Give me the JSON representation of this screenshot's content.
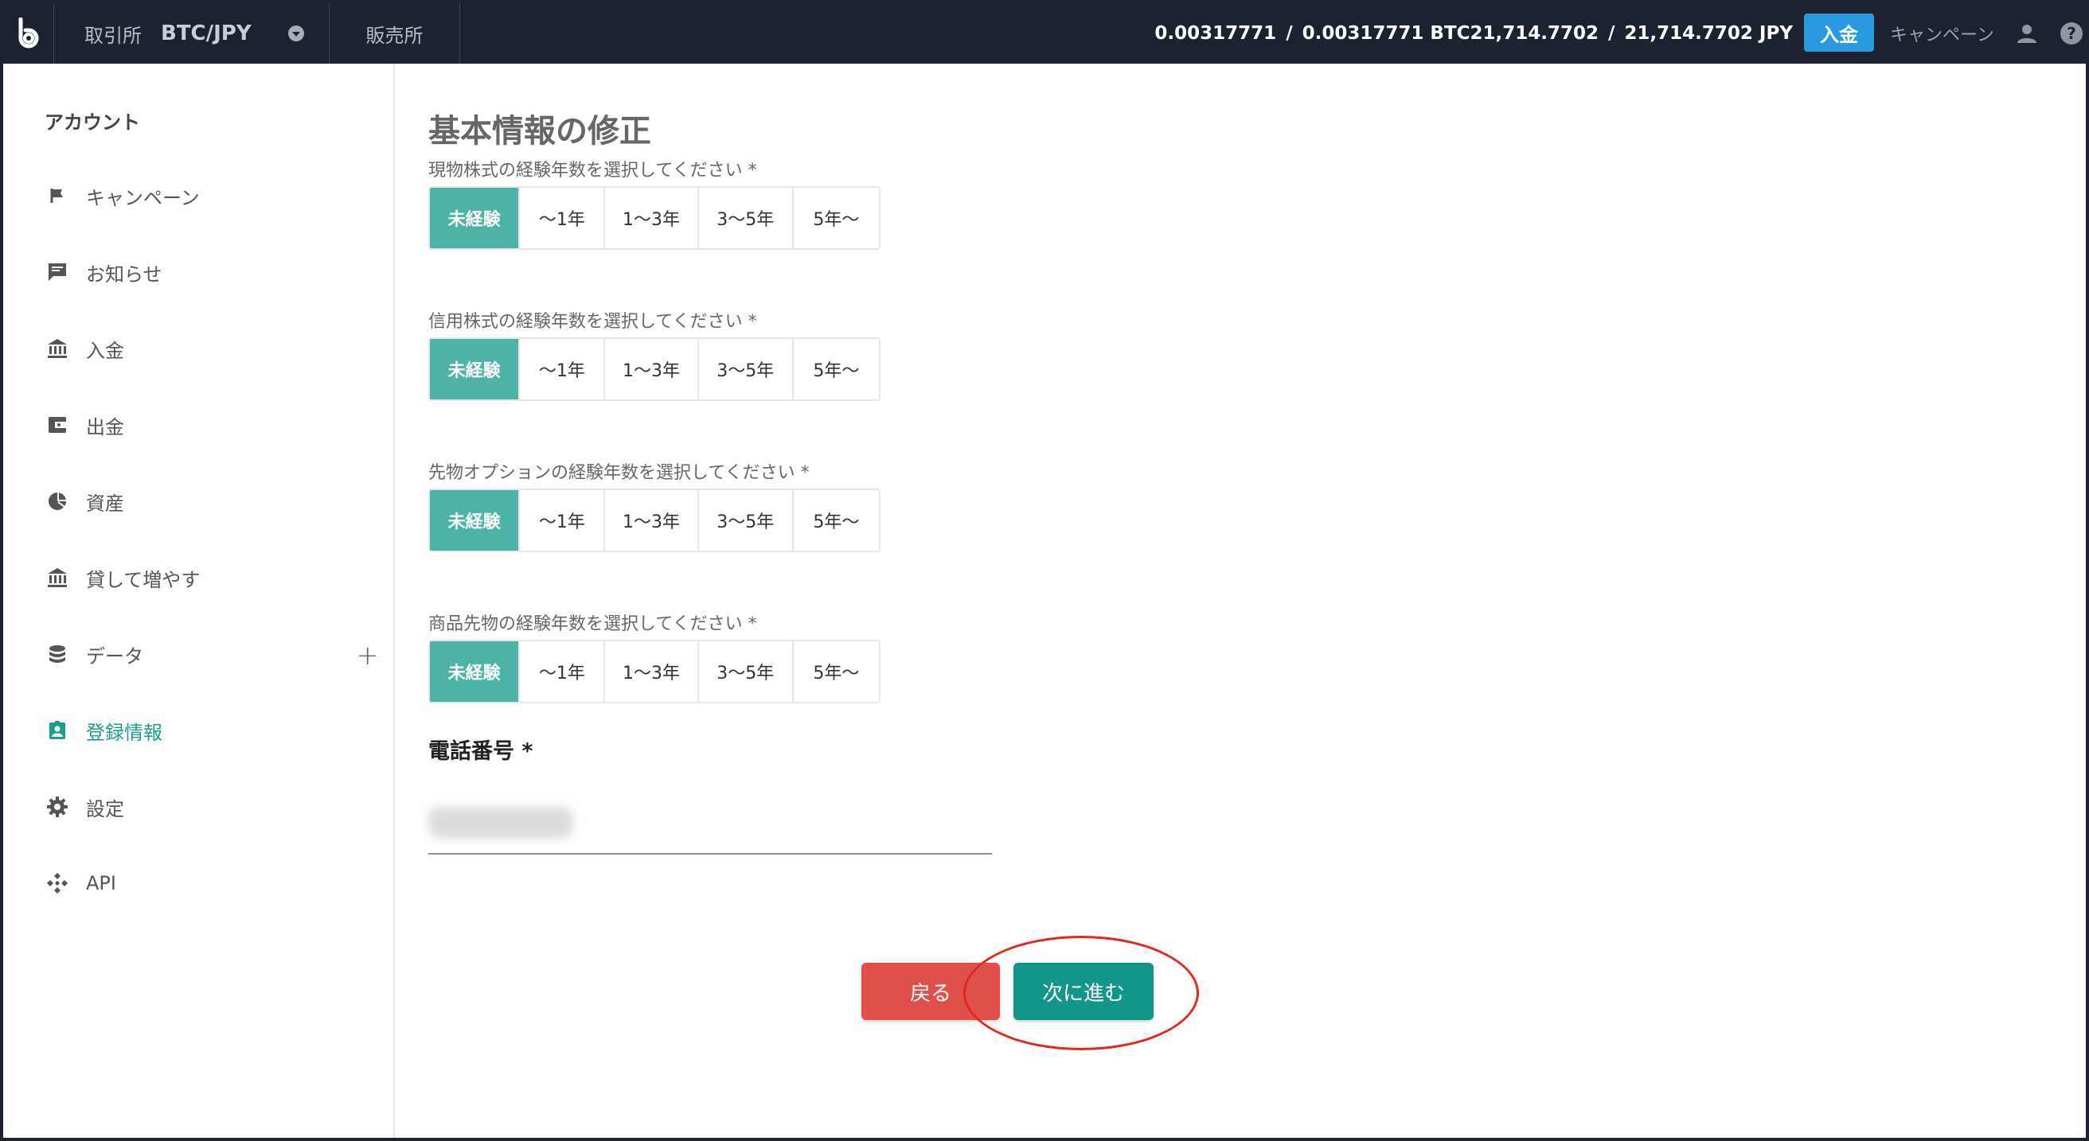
{
  "topbar": {
    "exchange_label": "取引所",
    "pair": "BTC/JPY",
    "shop_label": "販売所",
    "btc_available": "0.00317771",
    "btc_total": "0.00317771 BTC",
    "jpy_available": "21,714.7702",
    "jpy_total": "21,714.7702 JPY",
    "separator": "/",
    "deposit_label": "入金",
    "campaign_label": "キャンペーン",
    "accent": "#2a9ae0"
  },
  "sidebar": {
    "title": "アカウント",
    "items": [
      {
        "label": "キャンペーン",
        "icon": "flag-icon"
      },
      {
        "label": "お知らせ",
        "icon": "message-icon"
      },
      {
        "label": "入金",
        "icon": "bank-icon"
      },
      {
        "label": "出金",
        "icon": "wallet-icon"
      },
      {
        "label": "資産",
        "icon": "pie-chart-icon"
      },
      {
        "label": "貸して増やす",
        "icon": "bank-icon"
      },
      {
        "label": "データ",
        "icon": "database-icon",
        "expand": "+"
      },
      {
        "label": "登録情報",
        "icon": "id-card-icon",
        "active": true
      },
      {
        "label": "設定",
        "icon": "gear-icon"
      },
      {
        "label": "API",
        "icon": "api-icon"
      }
    ],
    "active_color": "#1a9e8e"
  },
  "form": {
    "title": "基本情報の修正",
    "options": [
      "未経験",
      "〜1年",
      "1〜3年",
      "3〜5年",
      "5年〜"
    ],
    "questions": [
      {
        "label": "現物株式の経験年数を選択してください *",
        "selected": "未経験"
      },
      {
        "label": "信用株式の経験年数を選択してください *",
        "selected": "未経験"
      },
      {
        "label": "先物オプションの経験年数を選択してください *",
        "selected": "未経験"
      },
      {
        "label": "商品先物の経験年数を選択してください *",
        "selected": "未経験"
      }
    ],
    "phone_label": "電話番号 *",
    "phone_value": "",
    "back_label": "戻る",
    "next_label": "次に進む",
    "selected_color": "#4cb3a6",
    "back_color": "#e0504a",
    "next_color": "#13968a"
  }
}
